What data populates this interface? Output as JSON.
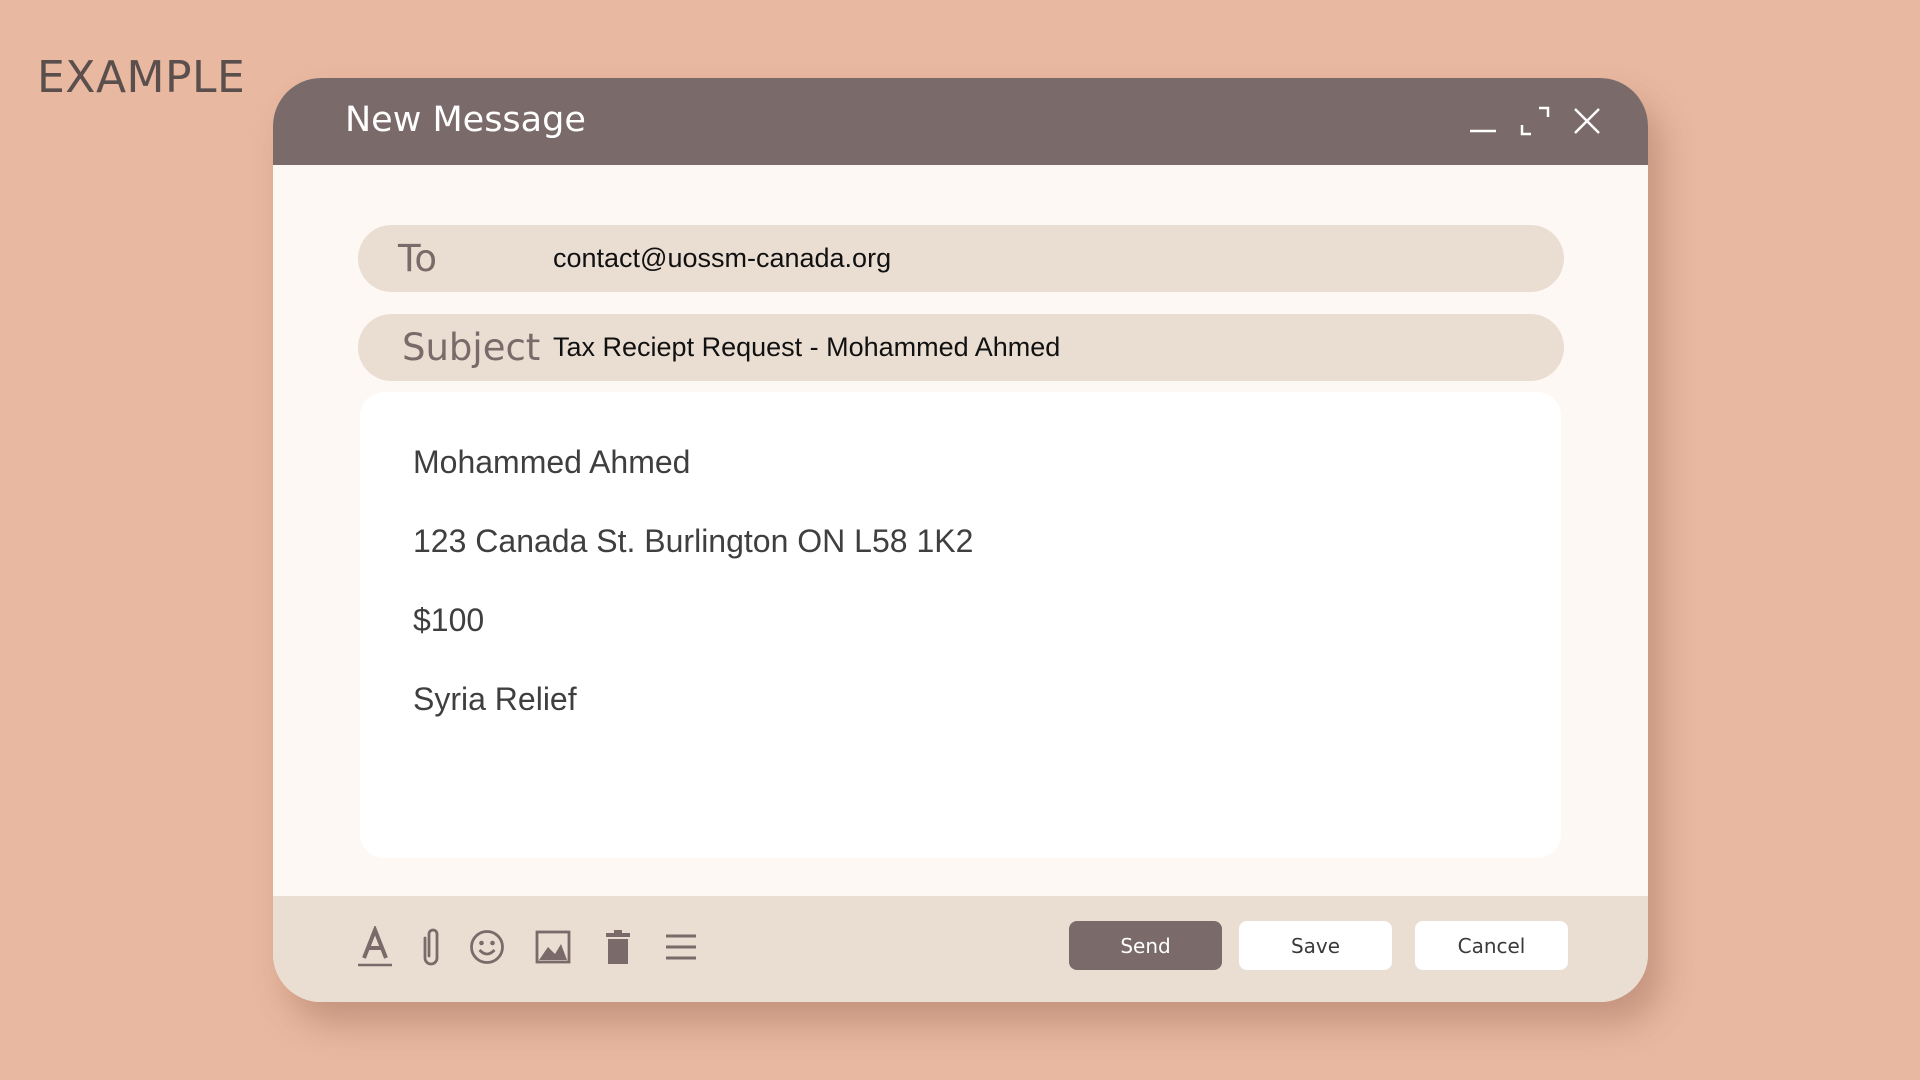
{
  "corner_label": "EXAMPLE",
  "window": {
    "title": "New Message"
  },
  "to": {
    "label": "To",
    "value": "contact@uossm-canada.org"
  },
  "subject": {
    "label": "Subject",
    "value": "Tax Reciept Request - Mohammed Ahmed"
  },
  "body": {
    "lines": [
      "Mohammed Ahmed",
      "123 Canada St. Burlington ON L58 1K2",
      "$100",
      "Syria Relief"
    ]
  },
  "toolbar": {
    "icons": [
      "text-format-icon",
      "paperclip-icon",
      "smiley-icon",
      "image-icon",
      "trash-icon",
      "menu-icon"
    ]
  },
  "actions": {
    "send_label": "Send",
    "save_label": "Save",
    "cancel_label": "Cancel"
  },
  "colors": {
    "background": "#E9B8A0",
    "titlebar": "#7A6A69",
    "field": "#EADED3",
    "window": "#FEF8F4"
  }
}
